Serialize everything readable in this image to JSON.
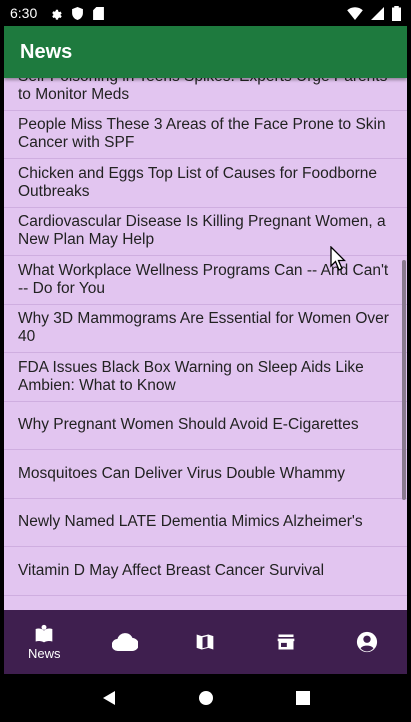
{
  "status": {
    "time": "6:30"
  },
  "app": {
    "title": "News"
  },
  "articles": [
    "Self-Poisoning in Teens Spikes: Experts Urge Parents to Monitor Meds",
    "People Miss These 3 Areas of the Face Prone to Skin Cancer with SPF",
    "Chicken and Eggs Top List of Causes for Foodborne Outbreaks",
    "Cardiovascular Disease Is Killing Pregnant Women, a New Plan May Help",
    "What Workplace Wellness Programs Can -- And Can't -- Do for You",
    "Why 3D Mammograms Are Essential for Women Over 40",
    "FDA Issues Black Box Warning on Sleep Aids Like Ambien: What to Know",
    "Why Pregnant Women Should Avoid E-Cigarettes",
    "Mosquitoes Can Deliver Virus Double Whammy",
    "Newly Named LATE Dementia Mimics Alzheimer's",
    "Vitamin D May Affect Breast Cancer Survival"
  ],
  "nav": {
    "items": [
      {
        "icon": "news-book-icon",
        "label": "News"
      },
      {
        "icon": "cloud-icon",
        "label": ""
      },
      {
        "icon": "map-icon",
        "label": ""
      },
      {
        "icon": "store-icon",
        "label": ""
      },
      {
        "icon": "account-circle-icon",
        "label": ""
      }
    ]
  },
  "colors": {
    "appbar": "#1e7a3e",
    "list_bg": "#e2c5f0",
    "bottom_nav": "#3f1f4f"
  }
}
